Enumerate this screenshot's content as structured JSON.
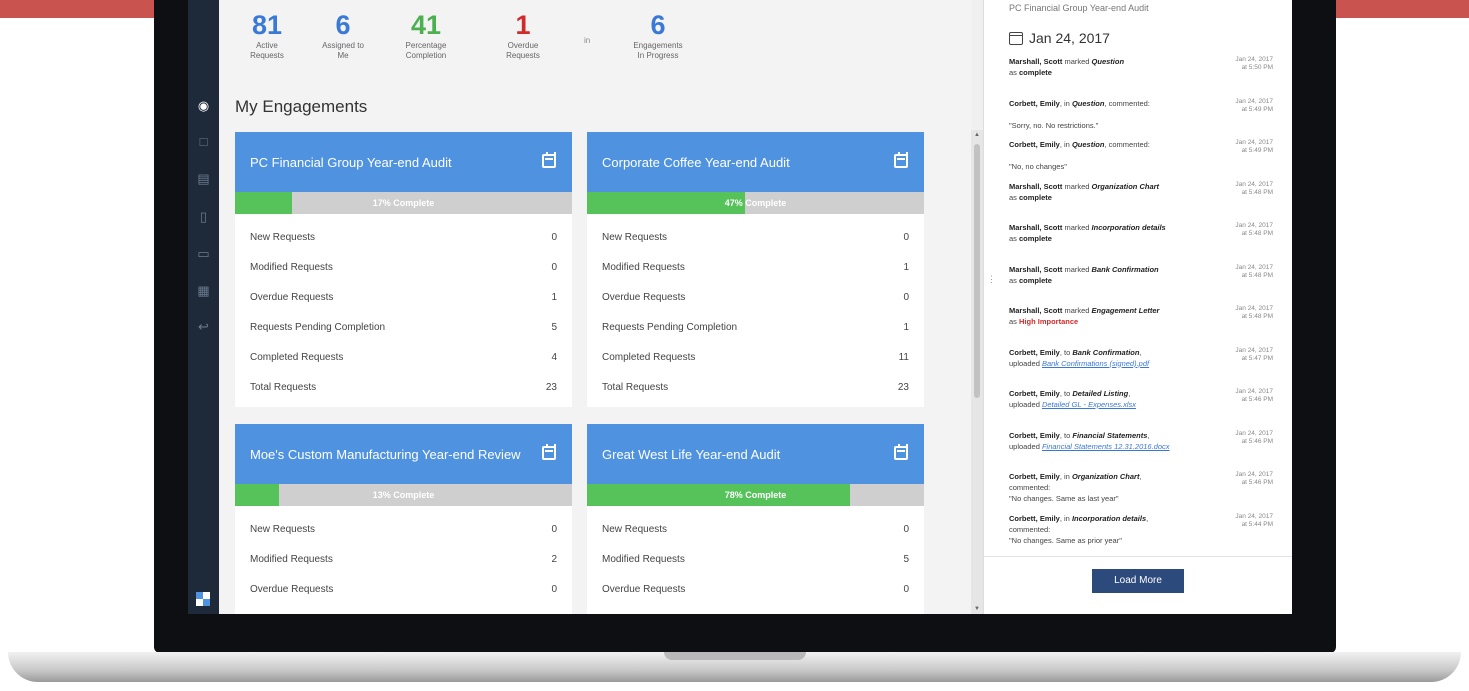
{
  "colors": {
    "top_bar": "#c9534f",
    "sidebar": "#1e2a3a",
    "card_header": "#4f92e0",
    "progress_fill": "#55c25a",
    "progress_track": "#cfcfcf",
    "stat_blue": "#3a7ad6",
    "stat_green": "#4cb050",
    "stat_red": "#d02a2a",
    "load_more": "#2d4a7c"
  },
  "sidebar": {
    "icons": [
      "dashboard-icon",
      "document-icon",
      "inbox-icon",
      "bookmark-icon",
      "contact-card-icon",
      "clipboard-icon",
      "logout-icon"
    ],
    "logo": "app-logo"
  },
  "stats": [
    {
      "value": "81",
      "label_1": "Active",
      "label_2": "Requests",
      "color": "#3a7ad6"
    },
    {
      "value": "6",
      "label_1": "Assigned to",
      "label_2": "Me",
      "color": "#3a7ad6"
    },
    {
      "value": "41",
      "label_1": "Percentage",
      "label_2": "Completion",
      "color": "#4cb050"
    },
    {
      "value": "1",
      "label_1": "Overdue",
      "label_2": "Requests",
      "color": "#d02a2a"
    },
    {
      "value": "6",
      "label_1": "Engagements",
      "label_2": "In Progress",
      "color": "#3a7ad6"
    }
  ],
  "stats_in_label": "in",
  "section_title": "My Engagements",
  "engagements": [
    {
      "title": "PC Financial Group Year-end Audit",
      "progress": 0.17,
      "progress_label": "17% Complete",
      "rows": [
        {
          "label": "New Requests",
          "value": "0"
        },
        {
          "label": "Modified Requests",
          "value": "0"
        },
        {
          "label": "Overdue Requests",
          "value": "1"
        },
        {
          "label": "Requests Pending Completion",
          "value": "5"
        },
        {
          "label": "Completed Requests",
          "value": "4"
        },
        {
          "label": "Total Requests",
          "value": "23"
        }
      ]
    },
    {
      "title": "Corporate Coffee Year-end Audit",
      "progress": 0.47,
      "progress_label": "47% Complete",
      "rows": [
        {
          "label": "New Requests",
          "value": "0"
        },
        {
          "label": "Modified Requests",
          "value": "1"
        },
        {
          "label": "Overdue Requests",
          "value": "0"
        },
        {
          "label": "Requests Pending Completion",
          "value": "1"
        },
        {
          "label": "Completed Requests",
          "value": "11"
        },
        {
          "label": "Total Requests",
          "value": "23"
        }
      ]
    },
    {
      "title": "Moe's Custom Manufacturing Year-end Review",
      "progress": 0.13,
      "progress_label": "13% Complete",
      "rows": [
        {
          "label": "New Requests",
          "value": "0"
        },
        {
          "label": "Modified Requests",
          "value": "2"
        },
        {
          "label": "Overdue Requests",
          "value": "0"
        }
      ]
    },
    {
      "title": "Great West Life Year-end Audit",
      "progress": 0.78,
      "progress_label": "78% Complete",
      "rows": [
        {
          "label": "New Requests",
          "value": "0"
        },
        {
          "label": "Modified Requests",
          "value": "5"
        },
        {
          "label": "Overdue Requests",
          "value": "0"
        }
      ]
    }
  ],
  "feed": {
    "header": "PC Financial Group Year-end Audit",
    "date": "Jan 24, 2017",
    "load_more": "Load More",
    "entries": [
      {
        "who": "Marshall, Scott",
        "pre": " marked ",
        "obj": "Question",
        "mid": "",
        "post": "as ",
        "bold": "complete",
        "boldClass": "bold",
        "link": "",
        "quote": "",
        "time1": "Jan 24, 2017",
        "time2": "at 5:50 PM"
      },
      {
        "who": "Corbett, Emily",
        "pre": ", in ",
        "obj": "Question",
        "mid": ", commented:",
        "post": "",
        "bold": "",
        "boldClass": "",
        "link": "",
        "quote": "\"Sorry, no. No restrictions.\"",
        "time1": "Jan 24, 2017",
        "time2": "at 5:49 PM"
      },
      {
        "who": "Corbett, Emily",
        "pre": ", in ",
        "obj": "Question",
        "mid": ", commented:",
        "post": "",
        "bold": "",
        "boldClass": "",
        "link": "",
        "quote": "\"No, no changes\"",
        "time1": "Jan 24, 2017",
        "time2": "at 5:49 PM"
      },
      {
        "who": "Marshall, Scott",
        "pre": " marked ",
        "obj": "Organization Chart",
        "mid": "",
        "post": "as ",
        "bold": "complete",
        "boldClass": "bold",
        "link": "",
        "quote": "",
        "time1": "Jan 24, 2017",
        "time2": "at 5:48 PM"
      },
      {
        "who": "Marshall, Scott",
        "pre": " marked ",
        "obj": "Incorporation details",
        "mid": "",
        "post": "as ",
        "bold": "complete",
        "boldClass": "bold",
        "link": "",
        "quote": "",
        "time1": "Jan 24, 2017",
        "time2": "at 5:48 PM"
      },
      {
        "who": "Marshall, Scott",
        "pre": " marked ",
        "obj": "Bank Confirmation",
        "mid": "",
        "post": "as ",
        "bold": "complete",
        "boldClass": "bold",
        "link": "",
        "quote": "",
        "time1": "Jan 24, 2017",
        "time2": "at 5:48 PM"
      },
      {
        "who": "Marshall, Scott",
        "pre": " marked ",
        "obj": "Engagement Letter",
        "mid": "",
        "post": "as ",
        "bold": "High Importance",
        "boldClass": "red",
        "link": "",
        "quote": "",
        "time1": "Jan 24, 2017",
        "time2": "at 5:48 PM"
      },
      {
        "who": "Corbett, Emily",
        "pre": ", to ",
        "obj": "Bank Confirmation",
        "mid": ",",
        "post": "uploaded ",
        "bold": "",
        "boldClass": "",
        "link": "Bank Confirmations (signed).pdf",
        "quote": "",
        "time1": "Jan 24, 2017",
        "time2": "at 5:47 PM"
      },
      {
        "who": "Corbett, Emily",
        "pre": ", to ",
        "obj": "Detailed Listing",
        "mid": ",",
        "post": "uploaded ",
        "bold": "",
        "boldClass": "",
        "link": "Detailed GL - Expenses.xlsx",
        "quote": "",
        "time1": "Jan 24, 2017",
        "time2": "at 5:46 PM"
      },
      {
        "who": "Corbett, Emily",
        "pre": ", to ",
        "obj": "Financial Statements",
        "mid": ",",
        "post": "uploaded ",
        "bold": "",
        "boldClass": "",
        "link": "Financial Statements 12.31.2016.docx",
        "quote": "",
        "time1": "Jan 24, 2017",
        "time2": "at 5:46 PM"
      },
      {
        "who": "Corbett, Emily",
        "pre": ", in ",
        "obj": "Organization Chart",
        "mid": ",",
        "post": "commented:",
        "bold": "",
        "boldClass": "",
        "link": "",
        "quote": "\"No changes. Same as last year\"",
        "time1": "Jan 24, 2017",
        "time2": "at 5:46 PM"
      },
      {
        "who": "Corbett, Emily",
        "pre": ", in ",
        "obj": "Incorporation details",
        "mid": ",",
        "post": "commented:",
        "bold": "",
        "boldClass": "",
        "link": "",
        "quote": "\"No changes. Same as prior year\"",
        "time1": "Jan 24, 2017",
        "time2": "at 5:44 PM"
      }
    ]
  }
}
